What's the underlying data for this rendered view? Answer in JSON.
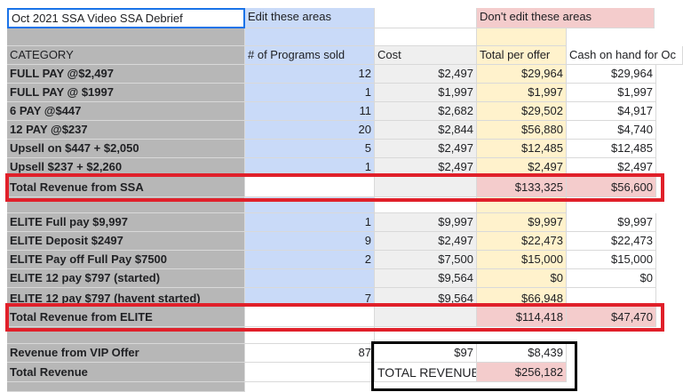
{
  "header": {
    "title": "Oct 2021 SSA Video SSA Debrief",
    "edit_label": "Edit these areas",
    "noedit_label": "Don't edit these areas"
  },
  "columns": [
    "CATEGORY",
    "# of Programs sold",
    "Cost",
    "Total per offer",
    "Cash on hand for Oc"
  ],
  "ssa_rows": [
    {
      "category": "FULL PAY @$2,497",
      "sold": "12",
      "cost": "$2,497",
      "total": "$29,964",
      "cash": "$29,964"
    },
    {
      "category": "FULL PAY @ $1997",
      "sold": "1",
      "cost": "$1,997",
      "total": "$1,997",
      "cash": "$1,997"
    },
    {
      "category": "6 PAY @$447",
      "sold": "11",
      "cost": "$2,682",
      "total": "$29,502",
      "cash": "$4,917"
    },
    {
      "category": "12 PAY @$237",
      "sold": "20",
      "cost": "$2,844",
      "total": "$56,880",
      "cash": "$4,740"
    },
    {
      "category": "Upsell on $447 + $2,050",
      "sold": "5",
      "cost": "$2,497",
      "total": "$12,485",
      "cash": "$12,485"
    },
    {
      "category": "Upsell $237 + $2,260",
      "sold": "1",
      "cost": "$2,497",
      "total": "$2,497",
      "cash": "$2,497"
    }
  ],
  "ssa_total": {
    "category": "Total Revenue from SSA",
    "total": "$133,325",
    "cash": "$56,600"
  },
  "elite_rows": [
    {
      "category": "ELITE Full pay $9,997",
      "sold": "1",
      "cost": "$9,997",
      "total": "$9,997",
      "cash": "$9,997"
    },
    {
      "category": "ELITE Deposit $2497",
      "sold": "9",
      "cost": "$2,497",
      "total": "$22,473",
      "cash": "$22,473"
    },
    {
      "category": "ELITE Pay off Full Pay $7500",
      "sold": "2",
      "cost": "$7,500",
      "total": "$15,000",
      "cash": "$15,000"
    },
    {
      "category": "ELITE 12 pay $797 (started)",
      "sold": "",
      "cost": "$9,564",
      "total": "$0",
      "cash": "$0"
    },
    {
      "category": "ELITE 12 pay $797 (havent started)",
      "sold": "7",
      "cost": "$9,564",
      "total": "$66,948",
      "cash": ""
    }
  ],
  "elite_total": {
    "category": "Total Revenue from ELITE",
    "total": "$114,418",
    "cash": "$47,470"
  },
  "vip": {
    "category": "Revenue from VIP Offer",
    "sold": "87",
    "cost": "$97",
    "total": "$8,439"
  },
  "grand": {
    "category": "Total Revenue",
    "label": "TOTAL REVENUE",
    "total": "$256,182"
  }
}
